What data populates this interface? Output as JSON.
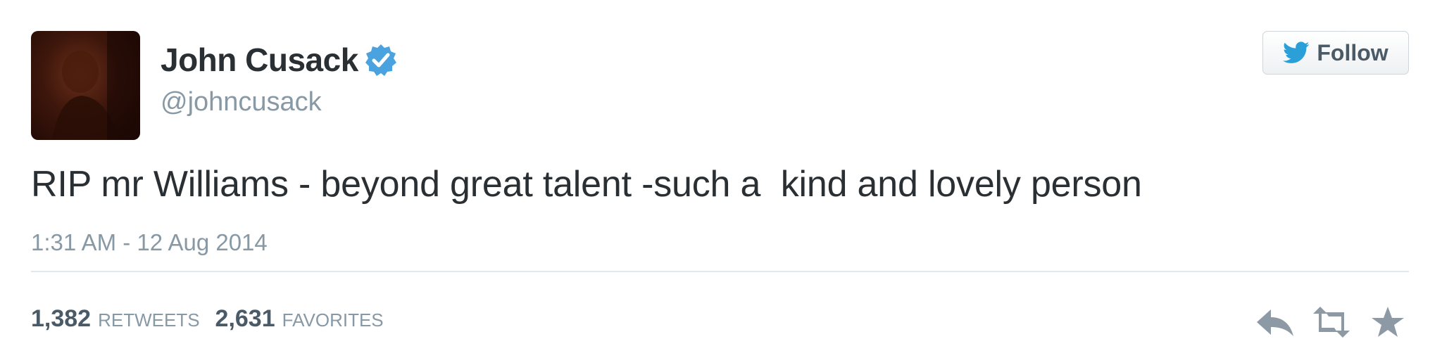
{
  "author": {
    "name": "John Cusack",
    "handle": "@johncusack",
    "verified": true
  },
  "follow_button": {
    "label": "Follow",
    "icon": "twitter-bird-icon"
  },
  "tweet": {
    "text": "RIP mr Williams - beyond great talent -such a  kind and lovely person",
    "timestamp": "1:31 AM - 12 Aug 2014"
  },
  "stats": {
    "retweets_count": "1,382",
    "retweets_label": "RETWEETS",
    "favorites_count": "2,631",
    "favorites_label": "FAVORITES"
  },
  "actions": [
    {
      "icon": "reply-icon"
    },
    {
      "icon": "retweet-icon"
    },
    {
      "icon": "favorite-star-icon"
    }
  ],
  "colors": {
    "verified_badge": "#4aa3df",
    "twitter_blue": "#2b9fd8",
    "text_primary": "#292f33",
    "text_secondary": "#8899a6",
    "action_icons": "#8d9aa5"
  }
}
